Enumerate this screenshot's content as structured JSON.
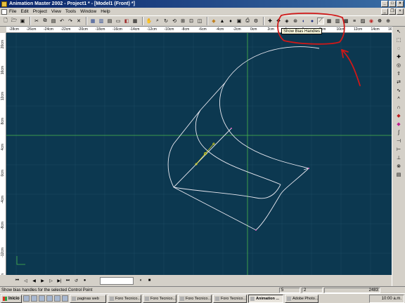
{
  "window": {
    "title": "Animation Master 2002 - Project1 * - [Model1 (Front) *]"
  },
  "menu": {
    "items": [
      "File",
      "Edit",
      "Project",
      "View",
      "Tools",
      "Window",
      "Help"
    ]
  },
  "tooltip": {
    "text": "Show Bias Handles"
  },
  "ruler_top": {
    "labels": [
      "-28cm",
      "-26cm",
      "-24cm",
      "-22cm",
      "-20cm",
      "-18cm",
      "-16cm",
      "-14cm",
      "-12cm",
      "-10cm",
      "-8cm",
      "-6cm",
      "-4cm",
      "-2cm",
      "0cm",
      "2cm",
      "4cm",
      "6cm",
      "8cm",
      "10cm",
      "12cm",
      "14cm",
      "16cm"
    ]
  },
  "ruler_left": {
    "labels": [
      "20cm",
      "16cm",
      "12cm",
      "8cm",
      "4cm",
      "0cm",
      "-4cm",
      "-8cm",
      "-12cm",
      "-16cm"
    ]
  },
  "viewport": {
    "background_color": "#0c3850",
    "spline_color": "#e8e8f0",
    "axis_color": "#4ab84a",
    "annotation_color": "#d01818",
    "control_point_color": "#e8e020"
  },
  "statusbar": {
    "message": "Show bias handles for the selected Control Point",
    "cells": [
      "5",
      "2",
      "2483"
    ]
  },
  "taskbar": {
    "start_label": "Inicio",
    "tasks": [
      {
        "label": "paginas web",
        "active": false
      },
      {
        "label": "Foro Tecnico...",
        "active": false
      },
      {
        "label": "Foro Tecnico...",
        "active": false
      },
      {
        "label": "Foro Tecnico...",
        "active": false
      },
      {
        "label": "Foro Tecnico...",
        "active": false
      },
      {
        "label": "Animation ...",
        "active": true
      },
      {
        "label": "Adobe Photo...",
        "active": false
      }
    ],
    "clock": "10:00 a.m."
  }
}
